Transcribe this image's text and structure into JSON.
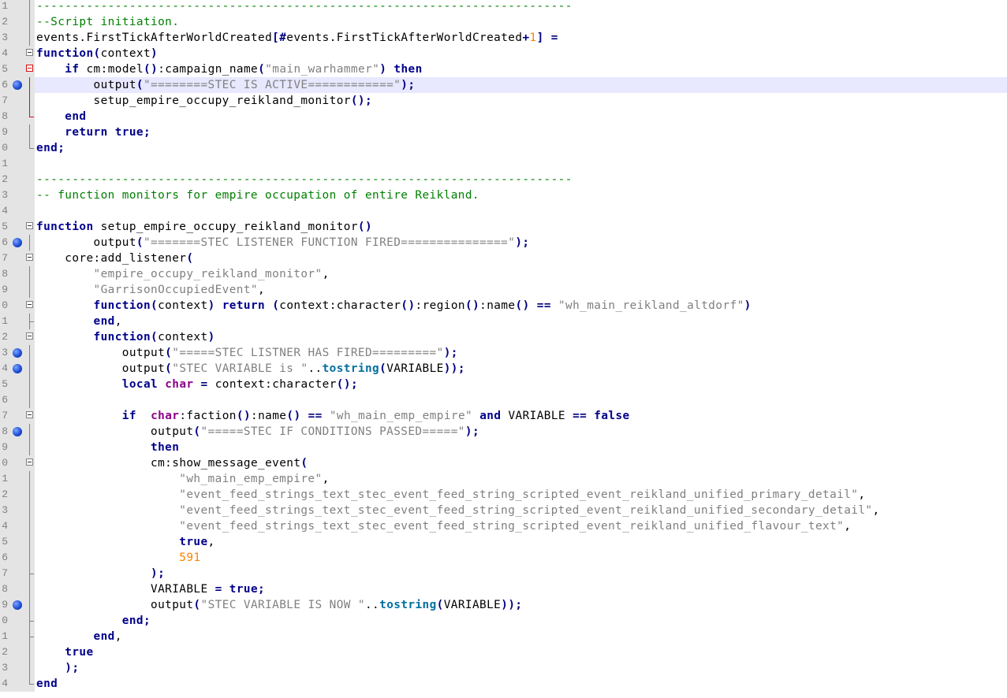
{
  "editor": {
    "lines": [
      {
        "n": "1",
        "text": "---------------------------------------------------------------------------"
      },
      {
        "n": "2",
        "text": "--Script initiation."
      },
      {
        "n": "3",
        "text": "events.FirstTickAfterWorldCreated[#events.FirstTickAfterWorldCreated+1] ="
      },
      {
        "n": "4",
        "text": "function(context)"
      },
      {
        "n": "5",
        "text": "    if cm:model():campaign_name(\"main_warhammer\") then"
      },
      {
        "n": "6",
        "text": "        output(\"========STEC IS ACTIVE============\");"
      },
      {
        "n": "7",
        "text": "        setup_empire_occupy_reikland_monitor();"
      },
      {
        "n": "8",
        "text": "    end"
      },
      {
        "n": "9",
        "text": "    return true;"
      },
      {
        "n": "0",
        "text": "end;"
      },
      {
        "n": "1",
        "text": ""
      },
      {
        "n": "2",
        "text": "---------------------------------------------------------------------------"
      },
      {
        "n": "3",
        "text": "-- function monitors for empire occupation of entire Reikland."
      },
      {
        "n": "4",
        "text": ""
      },
      {
        "n": "5",
        "text": "function setup_empire_occupy_reikland_monitor()"
      },
      {
        "n": "6",
        "text": "        output(\"=======STEC LISTENER FUNCTION FIRED===============\");"
      },
      {
        "n": "7",
        "text": "    core:add_listener("
      },
      {
        "n": "8",
        "text": "        \"empire_occupy_reikland_monitor\","
      },
      {
        "n": "9",
        "text": "        \"GarrisonOccupiedEvent\","
      },
      {
        "n": "0",
        "text": "        function(context) return (context:character():region():name() == \"wh_main_reikland_altdorf\")"
      },
      {
        "n": "1",
        "text": "        end,"
      },
      {
        "n": "2",
        "text": "        function(context)"
      },
      {
        "n": "3",
        "text": "            output(\"=====STEC LISTNER HAS FIRED=========\");"
      },
      {
        "n": "4",
        "text": "            output(\"STEC VARIABLE is \"..tostring(VARIABLE));"
      },
      {
        "n": "5",
        "text": "            local char = context:character();"
      },
      {
        "n": "6",
        "text": ""
      },
      {
        "n": "7",
        "text": "            if  char:faction():name() == \"wh_main_emp_empire\" and VARIABLE == false"
      },
      {
        "n": "8",
        "text": "                output(\"=====STEC IF CONDITIONS PASSED=====\");"
      },
      {
        "n": "9",
        "text": "                then"
      },
      {
        "n": "0",
        "text": "                cm:show_message_event("
      },
      {
        "n": "1",
        "text": "                    \"wh_main_emp_empire\","
      },
      {
        "n": "2",
        "text": "                    \"event_feed_strings_text_stec_event_feed_string_scripted_event_reikland_unified_primary_detail\","
      },
      {
        "n": "3",
        "text": "                    \"event_feed_strings_text_stec_event_feed_string_scripted_event_reikland_unified_secondary_detail\","
      },
      {
        "n": "4",
        "text": "                    \"event_feed_strings_text_stec_event_feed_string_scripted_event_reikland_unified_flavour_text\","
      },
      {
        "n": "5",
        "text": "                    true,"
      },
      {
        "n": "6",
        "text": "                    591"
      },
      {
        "n": "7",
        "text": "                );"
      },
      {
        "n": "8",
        "text": "                VARIABLE = true;"
      },
      {
        "n": "9",
        "text": "                output(\"STEC VARIABLE IS NOW \"..tostring(VARIABLE));"
      },
      {
        "n": "0",
        "text": "            end;"
      },
      {
        "n": "1",
        "text": "        end,"
      },
      {
        "n": "2",
        "text": "    true"
      },
      {
        "n": "3",
        "text": "    );"
      },
      {
        "n": "4",
        "text": "end"
      }
    ]
  },
  "breakpoint_lines": [
    5,
    15,
    22,
    23,
    27,
    38
  ],
  "current_line": 5,
  "fold_markers": [
    "line",
    "line",
    "line",
    "box",
    "box-red",
    "line-red",
    "line-red",
    "end-red",
    "line",
    "end",
    "none",
    "none",
    "none",
    "none",
    "box",
    "line",
    "box",
    "line",
    "line",
    "box",
    "end-line",
    "box",
    "line",
    "line",
    "line",
    "line",
    "box",
    "line",
    "line",
    "box",
    "line",
    "line",
    "line",
    "line",
    "line",
    "line",
    "end-line",
    "line",
    "line",
    "end-line",
    "end-line",
    "line",
    "line",
    "end"
  ],
  "syntax_colors": {
    "keyword": "#00008b",
    "string": "#808080",
    "comment": "#008000",
    "number": "#ff8000",
    "builtin": "#0070a0",
    "local_var": "#8b008b",
    "breakpoint": "#1f4fd8",
    "current_line_bg": "#e8e8ff",
    "gutter_bg": "#e4e4e4"
  }
}
